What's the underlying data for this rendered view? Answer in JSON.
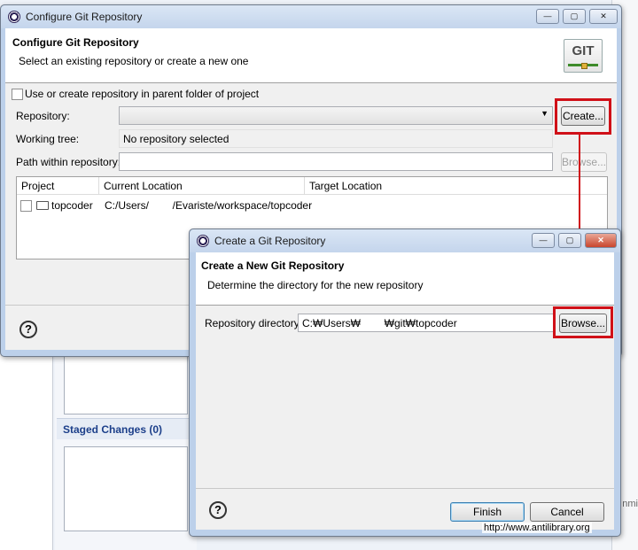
{
  "background": {
    "staged_changes": "Staged Changes (0)",
    "right_fragment": "nmi"
  },
  "configure": {
    "window_title": "Configure Git Repository",
    "header_title": "Configure Git Repository",
    "header_desc": "Select an existing repository or create a new one",
    "logo_text": "GIT",
    "parent_checkbox_label": "Use or create repository in parent folder of project",
    "repository_label": "Repository:",
    "repository_value": "",
    "create_button": "Create...",
    "working_tree_label": "Working tree:",
    "working_tree_value": "No repository selected",
    "path_label": "Path within repository:",
    "path_value": "",
    "browse_button": "Browse...",
    "table": {
      "columns": [
        "Project",
        "Current Location",
        "Target Location"
      ],
      "rows": [
        {
          "project": "topcoder",
          "current": "C:/Users/        /Evariste/workspace/topcoder",
          "target": ""
        }
      ]
    },
    "window_buttons": [
      "—",
      "▢",
      "✕"
    ]
  },
  "create": {
    "window_title": "Create a Git Repository",
    "header_title": "Create a New Git Repository",
    "header_desc": "Determine the directory for the new repository",
    "dir_label": "Repository directory:",
    "dir_value": "C:₩Users₩        ₩git₩topcoder",
    "browse_button": "Browse...",
    "finish_button": "Finish",
    "cancel_button": "Cancel",
    "window_buttons": [
      "—",
      "▢",
      "✕"
    ]
  },
  "watermark": "http://www.antilibrary.org",
  "colors": {
    "highlight": "#d01018",
    "title_bar": "#c4d5ec"
  }
}
